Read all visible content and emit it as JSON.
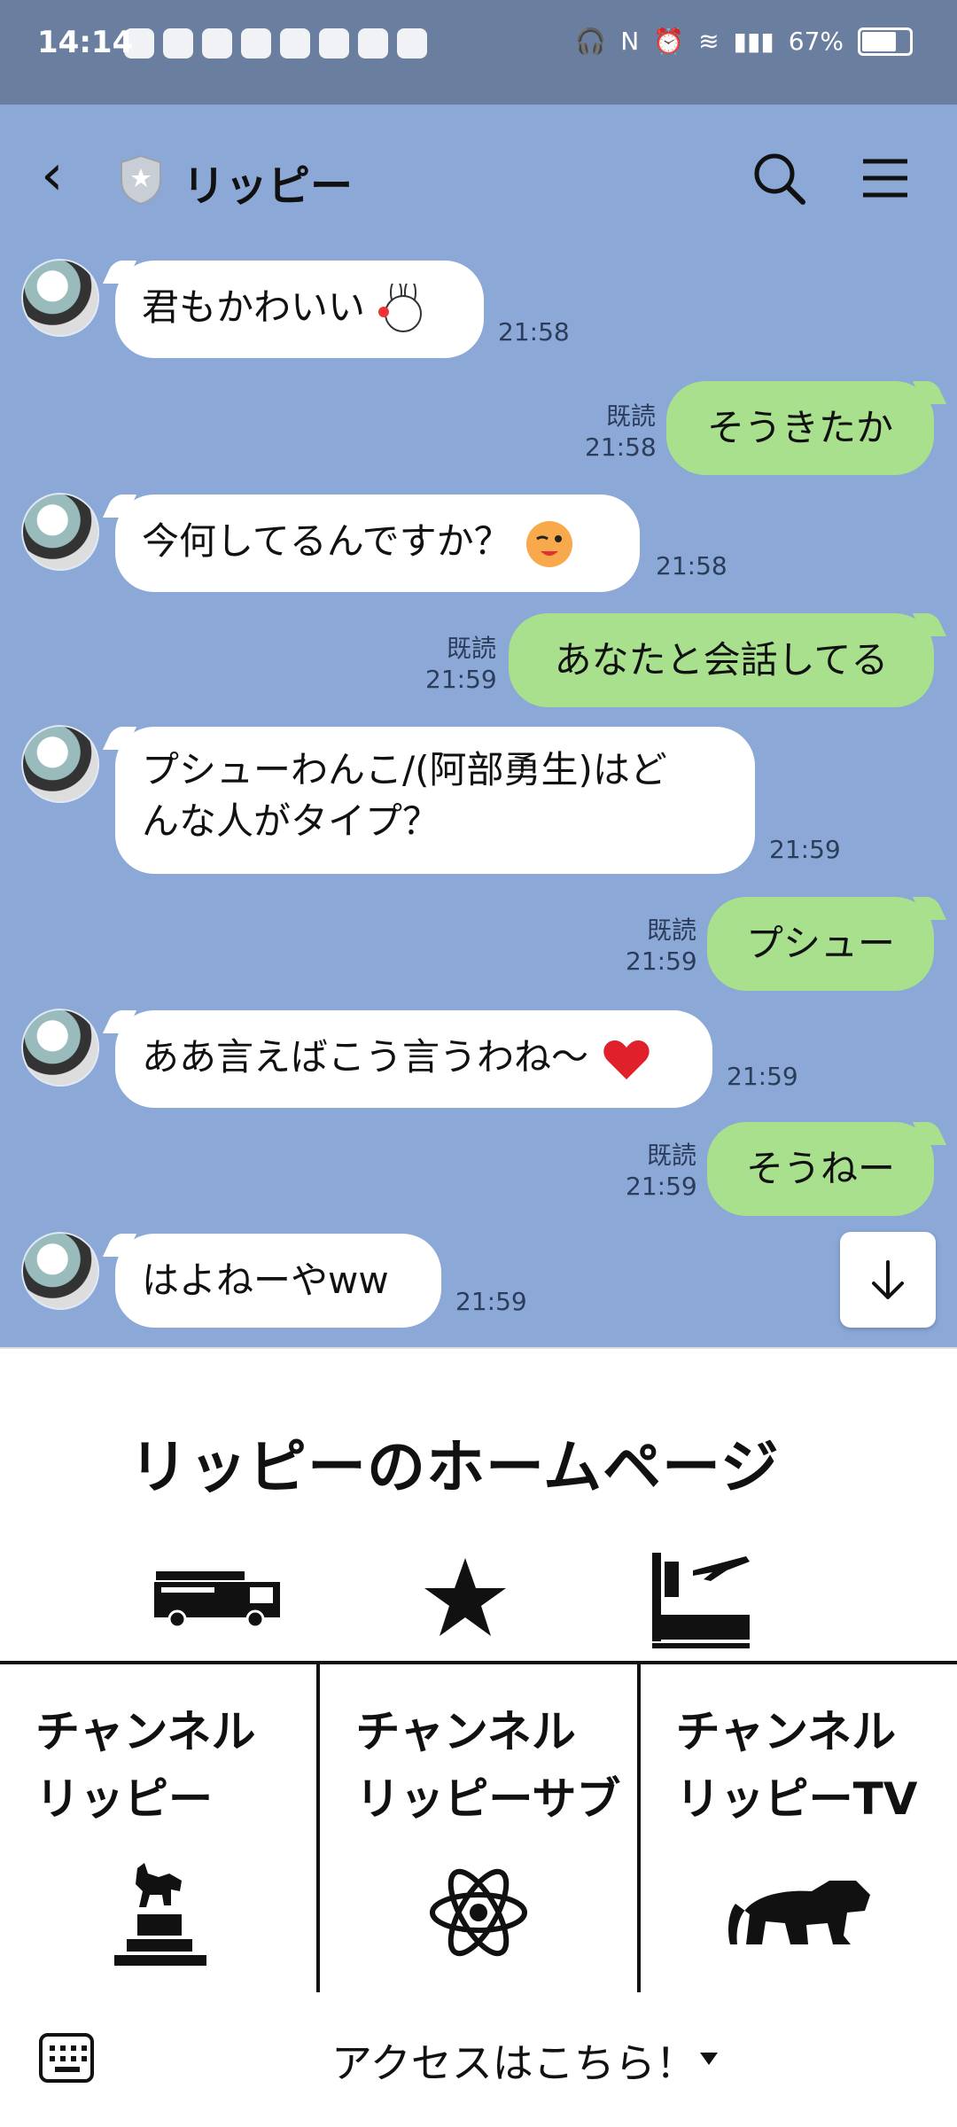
{
  "status": {
    "time": "14:14",
    "battery": "67%",
    "icons_left": [
      "youtube-icon",
      "circle-icon",
      "menu-icon",
      "game-icon",
      "app-icon",
      "gmail-icon",
      "file-icon",
      "vpn-icon"
    ],
    "icons_right": [
      "headphones-icon",
      "nfc-icon",
      "alarm-icon",
      "wifi-icon",
      "signal-icon",
      "battery-icon"
    ]
  },
  "header": {
    "title": "リッピー"
  },
  "messages": [
    {
      "side": "in",
      "text": "君もかわいい",
      "time": "21:58"
    },
    {
      "side": "out",
      "text": "そうきたか",
      "read": "既読",
      "time": "21:58"
    },
    {
      "side": "in",
      "text": "今何してるんですか？",
      "time": "21:58"
    },
    {
      "side": "out",
      "text": "あなたと会話してる",
      "read": "既読",
      "time": "21:59"
    },
    {
      "side": "in",
      "text": "プシューわんこ/(阿部勇生)はど\nんな人がタイプ？",
      "time": "21:59"
    },
    {
      "side": "out",
      "text": "プシュー",
      "read": "既読",
      "time": "21:59"
    },
    {
      "side": "in",
      "text": "ああ言えばこう言うわね〜",
      "time": "21:59"
    },
    {
      "side": "out",
      "text": "そうねー",
      "read": "既読",
      "time": "21:59"
    },
    {
      "side": "in",
      "text": "はよねーやww",
      "time": "21:59"
    }
  ],
  "panel": {
    "title": "リッピーのホームページ",
    "cells": [
      {
        "label": "チャンネル\nリッピー"
      },
      {
        "label": "チャンネル\nリッピーサブ"
      },
      {
        "label": "チャンネル\nリッピーTV"
      }
    ]
  },
  "bottom": {
    "access": "アクセスはこちら！"
  },
  "colors": {
    "chat_bg": "#8ba8d7",
    "out_bubble": "#a8e08e",
    "status_bg": "#6a7f9f"
  }
}
